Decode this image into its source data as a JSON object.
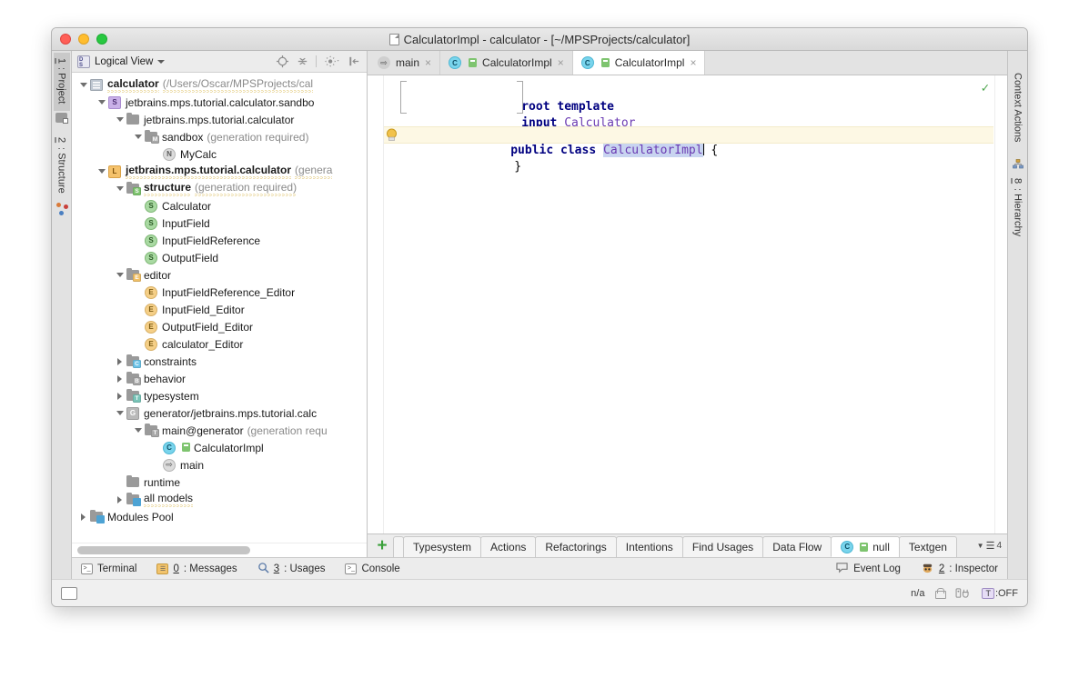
{
  "window": {
    "title": "CalculatorImpl - calculator - [~/MPSProjects/calculator]",
    "title_icon": "document-icon",
    "traffic": {
      "close": "close-window-button",
      "minimize": "minimize-window-button",
      "zoom": "zoom-window-button"
    }
  },
  "left_strip": {
    "tabs": [
      {
        "num": "1",
        "label": ": Project",
        "icon": "project-icon",
        "active": true
      },
      {
        "num": "2",
        "label": ": Structure",
        "icon": "structure-icon",
        "active": false
      }
    ]
  },
  "right_strip": {
    "tabs": [
      {
        "label": "Context Actions",
        "icon": "context-actions-icon"
      },
      {
        "num": "8",
        "label": ": Hierarchy",
        "icon": "hierarchy-icon"
      }
    ]
  },
  "project_panel": {
    "view_selector": "Logical View",
    "view_icon": "logical-view-icon",
    "tools": [
      "locate-icon",
      "collapse-all-icon",
      "settings-gear-icon",
      "hide-panel-icon"
    ],
    "tree": [
      {
        "indent": 0,
        "twisty": "down",
        "icon": "module-icon",
        "label": "calculator",
        "bold": true,
        "squiggly": true,
        "sub": "(/Users/Oscar/MPSProjects/cal"
      },
      {
        "indent": 1,
        "twisty": "down",
        "icon": "solution-s-icon",
        "label": "jetbrains.mps.tutorial.calculator.sandbo",
        "bold": false,
        "squiggly": false,
        "sub": ""
      },
      {
        "indent": 2,
        "twisty": "down",
        "icon": "folder-icon",
        "label": "jetbrains.mps.tutorial.calculator",
        "bold": false,
        "squiggly": false,
        "sub": ""
      },
      {
        "indent": 3,
        "twisty": "down",
        "icon": "model-m-icon",
        "label": "sandbox",
        "bold": false,
        "squiggly": false,
        "sub": "(generation required)"
      },
      {
        "indent": 4,
        "twisty": "none",
        "icon": "node-n-icon",
        "label": "MyCalc",
        "bold": false,
        "squiggly": false,
        "sub": ""
      },
      {
        "indent": 1,
        "twisty": "down",
        "icon": "language-l-icon",
        "label": "jetbrains.mps.tutorial.calculator",
        "bold": true,
        "squiggly": true,
        "sub": "(genera"
      },
      {
        "indent": 2,
        "twisty": "down",
        "icon": "folder-s-icon",
        "label": "structure",
        "bold": true,
        "squiggly": true,
        "sub": "(generation required)"
      },
      {
        "indent": 3,
        "twisty": "none",
        "icon": "concept-s-icon",
        "label": "Calculator",
        "bold": false,
        "squiggly": false,
        "sub": ""
      },
      {
        "indent": 3,
        "twisty": "none",
        "icon": "concept-s-icon",
        "label": "InputField",
        "bold": false,
        "squiggly": false,
        "sub": ""
      },
      {
        "indent": 3,
        "twisty": "none",
        "icon": "concept-s-icon",
        "label": "InputFieldReference",
        "bold": false,
        "squiggly": false,
        "sub": ""
      },
      {
        "indent": 3,
        "twisty": "none",
        "icon": "concept-s-icon",
        "label": "OutputField",
        "bold": false,
        "squiggly": false,
        "sub": ""
      },
      {
        "indent": 2,
        "twisty": "down",
        "icon": "folder-e-icon",
        "label": "editor",
        "bold": false,
        "squiggly": false,
        "sub": ""
      },
      {
        "indent": 3,
        "twisty": "none",
        "icon": "editor-e-icon",
        "label": "InputFieldReference_Editor",
        "bold": false,
        "squiggly": false,
        "sub": ""
      },
      {
        "indent": 3,
        "twisty": "none",
        "icon": "editor-e-icon",
        "label": "InputField_Editor",
        "bold": false,
        "squiggly": false,
        "sub": ""
      },
      {
        "indent": 3,
        "twisty": "none",
        "icon": "editor-e-icon",
        "label": "OutputField_Editor",
        "bold": false,
        "squiggly": false,
        "sub": ""
      },
      {
        "indent": 3,
        "twisty": "none",
        "icon": "editor-e-icon",
        "label": "calculator_Editor",
        "bold": false,
        "squiggly": false,
        "sub": ""
      },
      {
        "indent": 2,
        "twisty": "right",
        "icon": "folder-c-icon",
        "label": "constraints",
        "bold": false,
        "squiggly": false,
        "sub": ""
      },
      {
        "indent": 2,
        "twisty": "right",
        "icon": "folder-b-icon",
        "label": "behavior",
        "bold": false,
        "squiggly": false,
        "sub": ""
      },
      {
        "indent": 2,
        "twisty": "right",
        "icon": "folder-t-icon",
        "label": "typesystem",
        "bold": false,
        "squiggly": false,
        "sub": ""
      },
      {
        "indent": 2,
        "twisty": "down",
        "icon": "generator-g-icon",
        "label": "generator/jetbrains.mps.tutorial.calc",
        "bold": false,
        "squiggly": false,
        "sub": ""
      },
      {
        "indent": 3,
        "twisty": "down",
        "icon": "template-t-icon",
        "label": "main@generator",
        "bold": false,
        "squiggly": false,
        "sub": "(generation requ"
      },
      {
        "indent": 4,
        "twisty": "none",
        "icon": "class-c-icon",
        "label": "CalculatorImpl",
        "bold": false,
        "squiggly": false,
        "sub": ""
      },
      {
        "indent": 4,
        "twisty": "none",
        "icon": "mapping-arrow-icon",
        "label": "main",
        "bold": false,
        "squiggly": false,
        "sub": ""
      },
      {
        "indent": 2,
        "twisty": "none",
        "icon": "folder-icon",
        "label": "runtime",
        "bold": false,
        "squiggly": false,
        "sub": ""
      },
      {
        "indent": 2,
        "twisty": "right",
        "icon": "all-models-icon",
        "label": "all models",
        "bold": false,
        "squiggly": true,
        "sub": ""
      },
      {
        "indent": 0,
        "twisty": "right",
        "icon": "modules-pool-icon",
        "label": "Modules Pool",
        "bold": false,
        "squiggly": false,
        "sub": ""
      }
    ]
  },
  "editor": {
    "tabs": [
      {
        "label": "main",
        "icon": "mapping-arrow-icon",
        "active": false
      },
      {
        "label": "CalculatorImpl",
        "icon": "class-c-icon",
        "active": false
      },
      {
        "label": "CalculatorImpl",
        "icon": "class-c-icon",
        "active": true
      }
    ],
    "close_glyph": "×",
    "template_header": {
      "line1_kw": "root template",
      "line2_kw": "input",
      "line2_type": "Calculator"
    },
    "code": {
      "line1": {
        "kw1": "public",
        "kw2": "class",
        "name": "CalculatorImpl",
        "brace": "{"
      },
      "line2": "}"
    },
    "inspection_status": "ok-check-icon",
    "gutter_hint": "intention-bulb-icon"
  },
  "bottom_tabs": {
    "add_label": "+",
    "items": [
      {
        "label": "Typesystem",
        "active": false
      },
      {
        "label": "Actions",
        "active": false
      },
      {
        "label": "Refactorings",
        "active": false
      },
      {
        "label": "Intentions",
        "active": false
      },
      {
        "label": "Find Usages",
        "active": false
      },
      {
        "label": "Data Flow",
        "active": false
      },
      {
        "label": "null",
        "active": true,
        "icon": "class-c-icon"
      },
      {
        "label": "Textgen",
        "active": false
      }
    ],
    "overflow_count": "4"
  },
  "status_tools": {
    "left": [
      {
        "label": "Terminal",
        "icon": "terminal-icon",
        "num": ""
      },
      {
        "label": ": Messages",
        "icon": "messages-icon",
        "num": "0"
      },
      {
        "label": ": Usages",
        "icon": "search-icon",
        "num": "3"
      },
      {
        "label": "Console",
        "icon": "console-icon",
        "num": ""
      }
    ],
    "right": [
      {
        "label": "Event Log",
        "icon": "event-log-icon",
        "num": ""
      },
      {
        "label": ": Inspector",
        "icon": "inspector-icon",
        "num": "2"
      }
    ]
  },
  "os_bar": {
    "left_icon": "desktop-icon",
    "encoding": "n/a",
    "lock": "lock-icon",
    "plug": "plug-icon",
    "keymap_tag": "T",
    "keymap_state": ":OFF"
  },
  "colors": {
    "accent_green": "#3aa03a",
    "keyword_blue": "#000080",
    "type_purple": "#6a3ab2",
    "selection": "#c8d4f0",
    "line_highlight": "#fdf8e4",
    "squiggly": "#cfa521"
  }
}
